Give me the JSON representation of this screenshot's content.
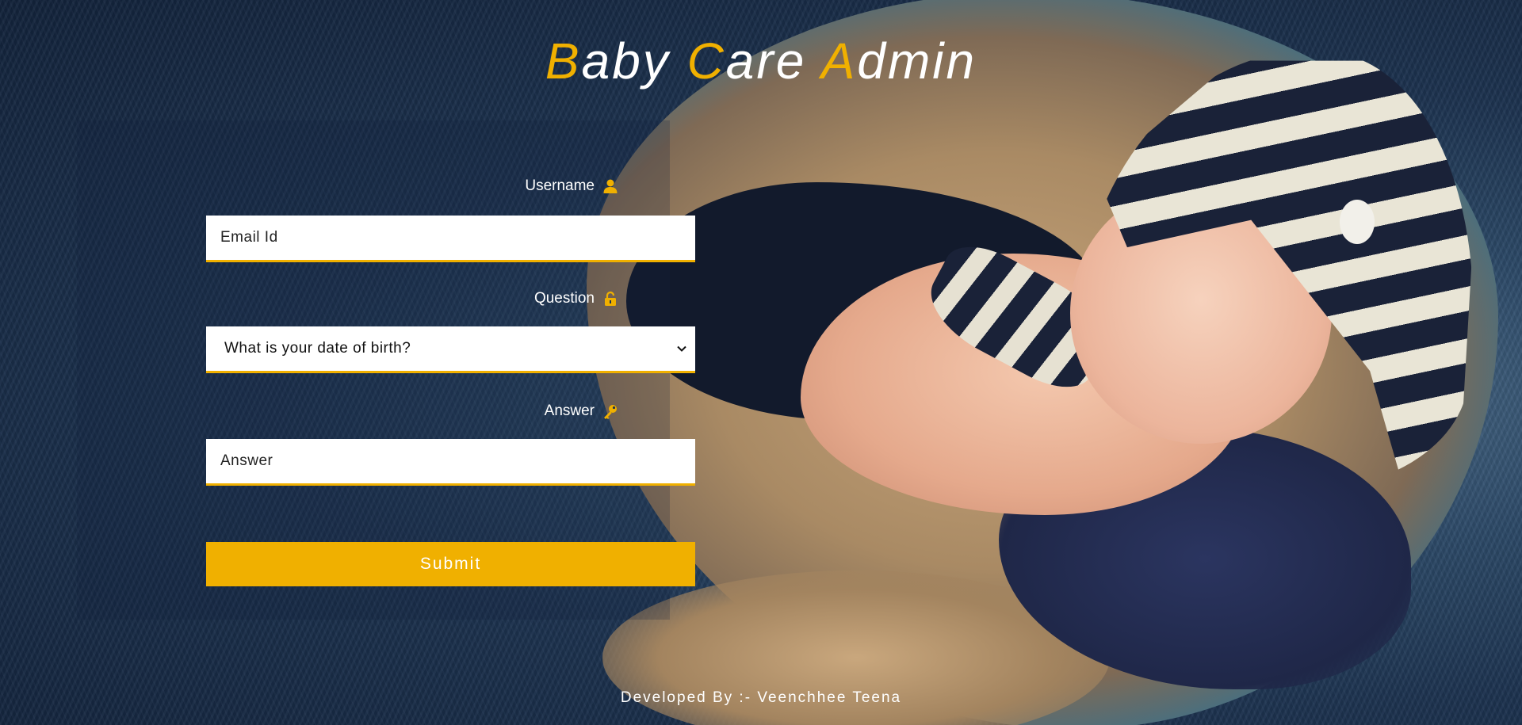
{
  "app": {
    "title_parts": [
      {
        "cap": "B",
        "rest": "aby "
      },
      {
        "cap": "C",
        "rest": "are "
      },
      {
        "cap": "A",
        "rest": "dmin"
      }
    ]
  },
  "colors": {
    "accent": "#f0b000",
    "text": "#ffffff"
  },
  "form": {
    "username": {
      "label": "Username",
      "icon": "user-icon",
      "placeholder": "Email Id"
    },
    "question": {
      "label": "Question",
      "icon": "lock-open-icon",
      "selected": "What is your date of birth?"
    },
    "answer": {
      "label": "Answer",
      "icon": "key-icon",
      "placeholder": "Answer"
    },
    "submit_label": "Submit"
  },
  "footer": {
    "text": "Developed By :- Veenchhee Teena"
  }
}
